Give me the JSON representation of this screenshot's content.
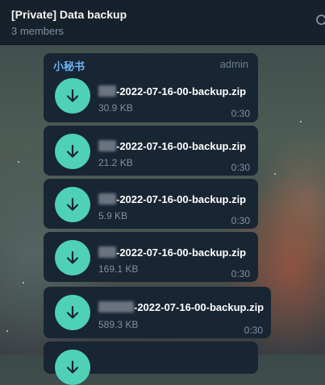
{
  "header": {
    "title": "[Private] Data backup",
    "subtitle": "3 members",
    "search_icon": "search-icon"
  },
  "sender": {
    "name": "小秘书",
    "role": "admin"
  },
  "messages": [
    {
      "name_suffix": "-2022-07-16-00-backup.zip",
      "size": "30.9 KB",
      "time": "0:30"
    },
    {
      "name_suffix": "-2022-07-16-00-backup.zip",
      "size": "21.2 KB",
      "time": "0:30"
    },
    {
      "name_suffix": "-2022-07-16-00-backup.zip",
      "size": "5.9 KB",
      "time": "0:30"
    },
    {
      "name_suffix": "-2022-07-16-00-backup.zip",
      "size": "169.1 KB",
      "time": "0:30"
    },
    {
      "name_suffix": "-2022-07-16-00-backup.zip",
      "size": "589.3 KB",
      "time": "0:30"
    }
  ],
  "colors": {
    "accent": "#4fd1b8",
    "sender": "#6ab3f3",
    "bubble": "#182533",
    "header": "#17212b"
  }
}
